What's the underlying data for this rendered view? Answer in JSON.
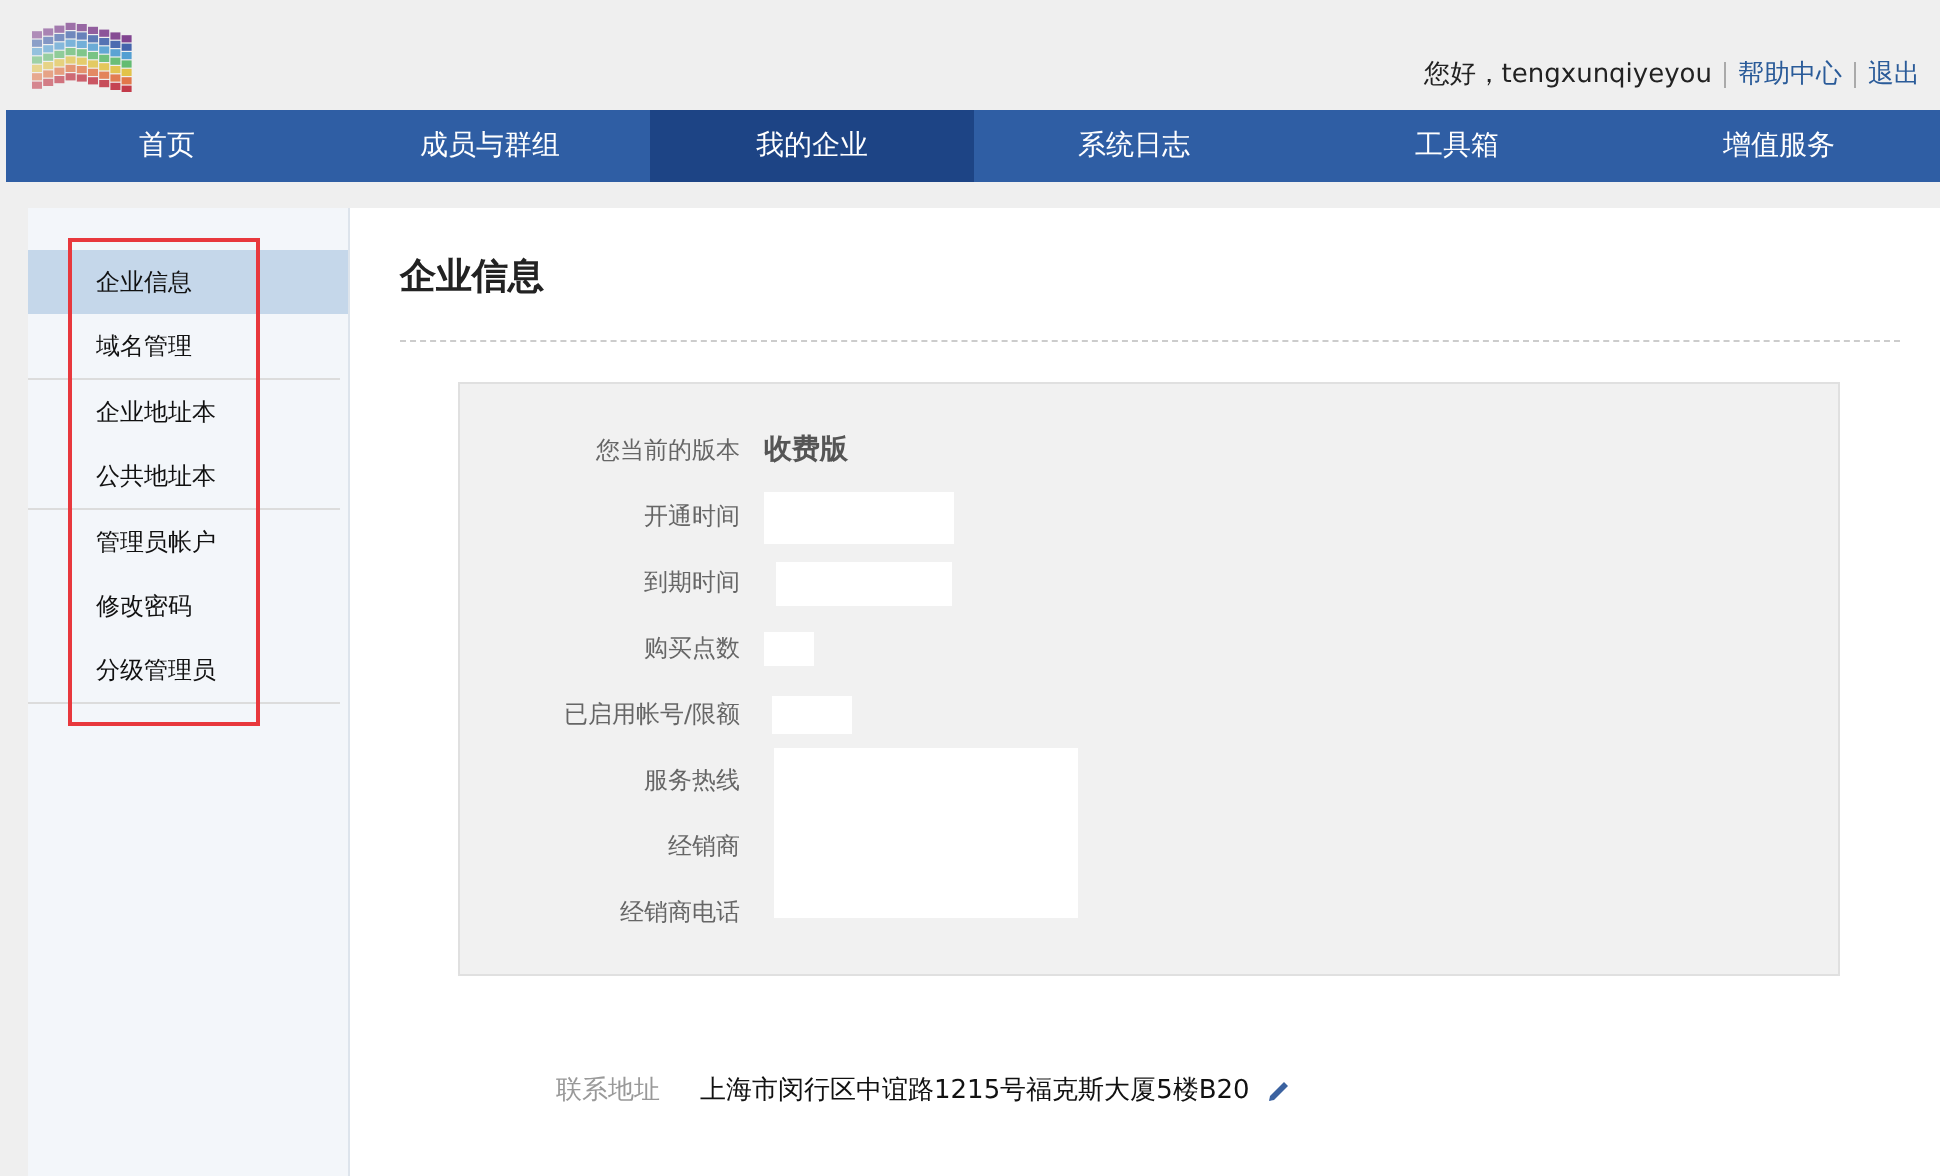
{
  "header": {
    "greeting": "您好，tengxunqiyeyou",
    "links": [
      "帮助中心",
      "退出"
    ]
  },
  "nav": [
    {
      "label": "首页",
      "selected": false
    },
    {
      "label": "成员与群组",
      "selected": false
    },
    {
      "label": "我的企业",
      "selected": true
    },
    {
      "label": "系统日志",
      "selected": false
    },
    {
      "label": "工具箱",
      "selected": false
    },
    {
      "label": "增值服务",
      "selected": false
    }
  ],
  "sidebar": {
    "groups": [
      [
        {
          "label": "企业信息",
          "selected": true
        },
        {
          "label": "域名管理",
          "selected": false
        }
      ],
      [
        {
          "label": "企业地址本",
          "selected": false
        },
        {
          "label": "公共地址本",
          "selected": false
        }
      ],
      [
        {
          "label": "管理员帐户",
          "selected": false
        },
        {
          "label": "修改密码",
          "selected": false
        },
        {
          "label": "分级管理员",
          "selected": false
        }
      ]
    ]
  },
  "page_title": "企业信息",
  "info": {
    "rows": [
      {
        "label": "您当前的版本",
        "kind": "text",
        "value": "收费版"
      },
      {
        "label": "开通时间",
        "kind": "blank"
      },
      {
        "label": "到期时间",
        "kind": "blank"
      },
      {
        "label": "购买点数",
        "kind": "blank"
      },
      {
        "label": "已启用帐号/限额",
        "kind": "blank"
      },
      {
        "label": "服务热线",
        "kind": "area"
      },
      {
        "label": "经销商",
        "kind": "area"
      },
      {
        "label": "经销商电话",
        "kind": "area"
      }
    ]
  },
  "address": {
    "label": "联系地址",
    "value": "上海市闵行区中谊路1215号福克斯大厦5楼B20"
  }
}
